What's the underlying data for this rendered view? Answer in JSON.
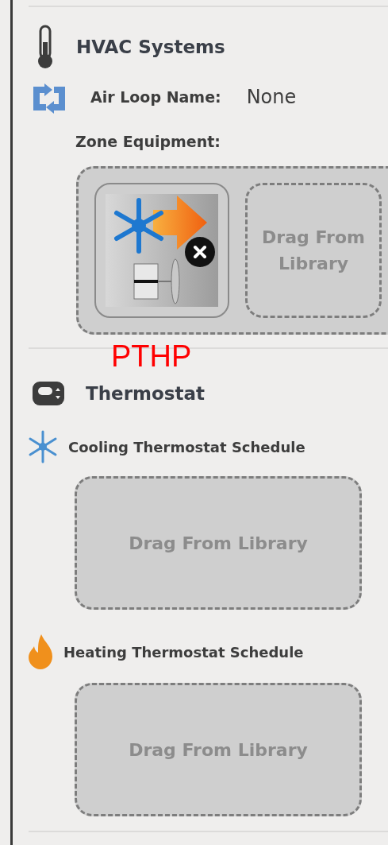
{
  "hvac": {
    "title": "HVAC Systems",
    "air_loop_label": "Air Loop Name:",
    "air_loop_value": "None",
    "zone_equipment_label": "Zone Equipment:",
    "equipment": [
      {
        "kind": "item",
        "caption": "PTHP"
      },
      {
        "kind": "drop",
        "text": "Drag From Library"
      }
    ]
  },
  "thermostat": {
    "title": "Thermostat",
    "schedules": [
      {
        "kind": "cooling",
        "label": "Cooling Thermostat Schedule",
        "drop": "Drag From Library"
      },
      {
        "kind": "heating",
        "label": "Heating Thermostat Schedule",
        "drop": "Drag From Library"
      }
    ]
  }
}
